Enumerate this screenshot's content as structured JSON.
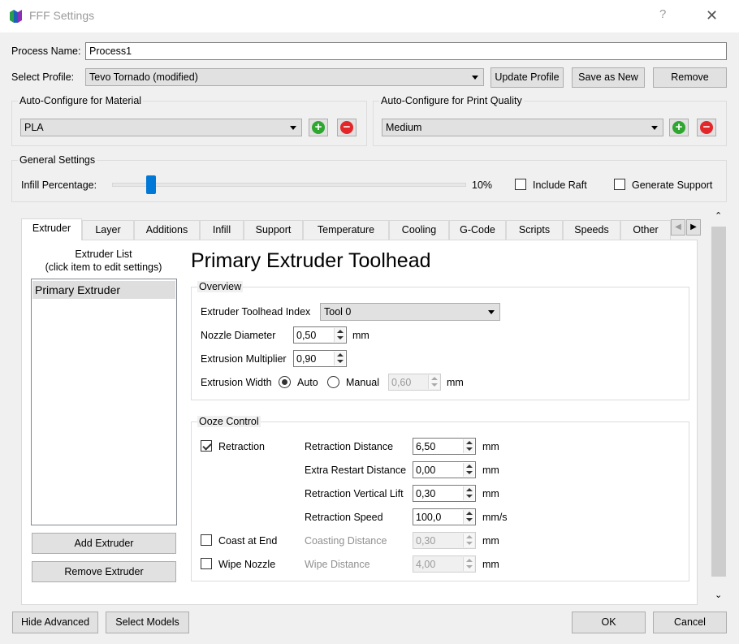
{
  "window": {
    "title": "FFF Settings",
    "help": "?",
    "close": "✕",
    "app_icon": "simplify3d-icon"
  },
  "process": {
    "label": "Process Name:",
    "value": "Process1"
  },
  "profile": {
    "label": "Select Profile:",
    "value": "Tevo Tornado (modified)",
    "update_label": "Update Profile",
    "save_label": "Save as New",
    "remove_label": "Remove"
  },
  "material": {
    "title": "Auto-Configure for Material",
    "value": "PLA"
  },
  "quality": {
    "title": "Auto-Configure for Print Quality",
    "value": "Medium"
  },
  "general": {
    "title": "General Settings",
    "infill_label": "Infill Percentage:",
    "infill_value": "10%",
    "infill_fraction": 0.1,
    "raft_label": "Include Raft",
    "raft_checked": false,
    "support_label": "Generate Support",
    "support_checked": false
  },
  "tabs": [
    "Extruder",
    "Layer",
    "Additions",
    "Infill",
    "Support",
    "Temperature",
    "Cooling",
    "G-Code",
    "Scripts",
    "Speeds",
    "Other"
  ],
  "active_tab": "Extruder",
  "extruder_list": {
    "title_line1": "Extruder List",
    "title_line2": "(click item to edit settings)",
    "items": [
      "Primary Extruder"
    ],
    "add_label": "Add Extruder",
    "remove_label": "Remove Extruder"
  },
  "heading": "Primary Extruder Toolhead",
  "overview": {
    "title": "Overview",
    "toolhead_label": "Extruder Toolhead Index",
    "toolhead_value": "Tool 0",
    "nozzle_label": "Nozzle Diameter",
    "nozzle_value": "0,50",
    "nozzle_unit": "mm",
    "mult_label": "Extrusion Multiplier",
    "mult_value": "0,90",
    "width_label": "Extrusion Width",
    "auto_label": "Auto",
    "manual_label": "Manual",
    "width_value": "0,60",
    "width_unit": "mm",
    "width_mode": "Auto"
  },
  "ooze": {
    "title": "Ooze Control",
    "retraction_label": "Retraction",
    "retraction_checked": true,
    "coast_label": "Coast at End",
    "coast_checked": false,
    "wipe_label": "Wipe Nozzle",
    "wipe_checked": false,
    "fields": [
      {
        "label": "Retraction Distance",
        "value": "6,50",
        "unit": "mm",
        "enabled": true
      },
      {
        "label": "Extra Restart Distance",
        "value": "0,00",
        "unit": "mm",
        "enabled": true
      },
      {
        "label": "Retraction Vertical Lift",
        "value": "0,30",
        "unit": "mm",
        "enabled": true
      },
      {
        "label": "Retraction Speed",
        "value": "100,0",
        "unit": "mm/s",
        "enabled": true
      },
      {
        "label": "Coasting Distance",
        "value": "0,30",
        "unit": "mm",
        "enabled": false
      },
      {
        "label": "Wipe Distance",
        "value": "4,00",
        "unit": "mm",
        "enabled": false
      }
    ]
  },
  "footer": {
    "hide_label": "Hide Advanced",
    "select_label": "Select Models",
    "ok_label": "OK",
    "cancel_label": "Cancel"
  },
  "colors": {
    "accent": "#0078d7",
    "plus": "#2fa62f",
    "minus": "#e3262a"
  }
}
